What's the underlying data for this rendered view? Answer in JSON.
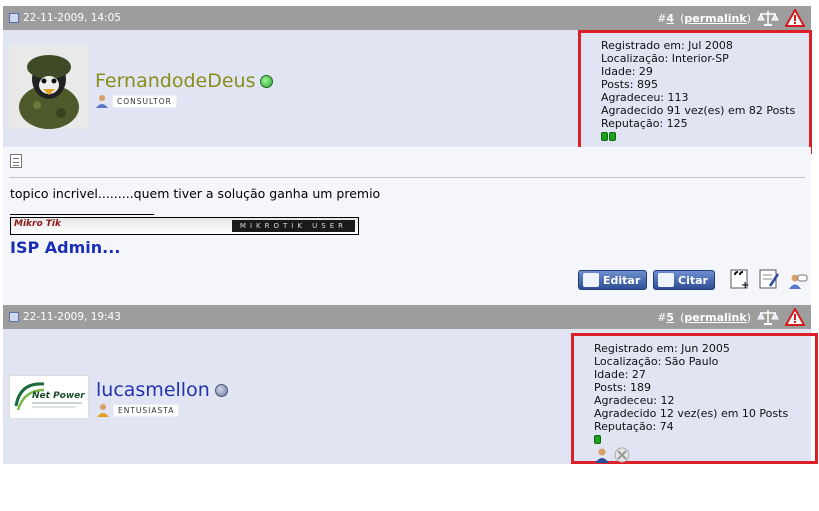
{
  "posts": [
    {
      "date": "22-11-2009, 14:05",
      "number_prefix": "#",
      "number": "4",
      "permalink": "permalink",
      "username": "FernandodeDeus",
      "username_color": "#8a8c1a",
      "status": "online",
      "status_color": "#2ea52e",
      "rank": "CONSULTOR",
      "info": {
        "registered": "Registrado em: Jul 2008",
        "location": "Localização: Interior-SP",
        "age": "Idade: 29",
        "posts": "Posts: 895",
        "thanked": "Agradeceu: 113",
        "thanked_by": "Agradecido 91 vez(es) em 82 Posts",
        "reputation": "Reputação: 125"
      },
      "reputation_blocks": 2,
      "message": "topico incrivel.........quem tiver a solução ganha um premio",
      "signature_banner_logo": "Mikro Tik",
      "signature_banner_text": "MIKROTIK USER",
      "signature_text": "ISP Admin...",
      "buttons": {
        "edit": "Editar",
        "quote": "Citar"
      }
    },
    {
      "date": "22-11-2009, 19:43",
      "number_prefix": "#",
      "number": "5",
      "permalink": "permalink",
      "username": "lucasmellon",
      "username_color": "#2233aa",
      "status": "offline",
      "status_color": "#7a86a8",
      "rank": "ENTUSIASTA",
      "avatar_text": "Net Power",
      "info": {
        "registered": "Registrado em: Jun 2005",
        "location": "Localização: São Paulo",
        "age": "Idade: 27",
        "posts": "Posts: 189",
        "thanked": "Agradeceu: 12",
        "thanked_by": "Agradecido 12 vez(es) em 10 Posts",
        "reputation": "Reputação: 74"
      },
      "reputation_blocks": 1
    }
  ],
  "icons": [
    "date-icon",
    "scale-icon",
    "warning-icon",
    "document-icon",
    "edit-icon",
    "quote-icon",
    "multi-quote-icon",
    "quick-reply-icon",
    "ip-icon",
    "profile-icon",
    "block-icon"
  ],
  "colors": {
    "header_bar": "#9d9d9d",
    "user_row": "#e1e4f2",
    "highlight_border": "#dd1f2a",
    "signature": "#1a2fb5"
  }
}
